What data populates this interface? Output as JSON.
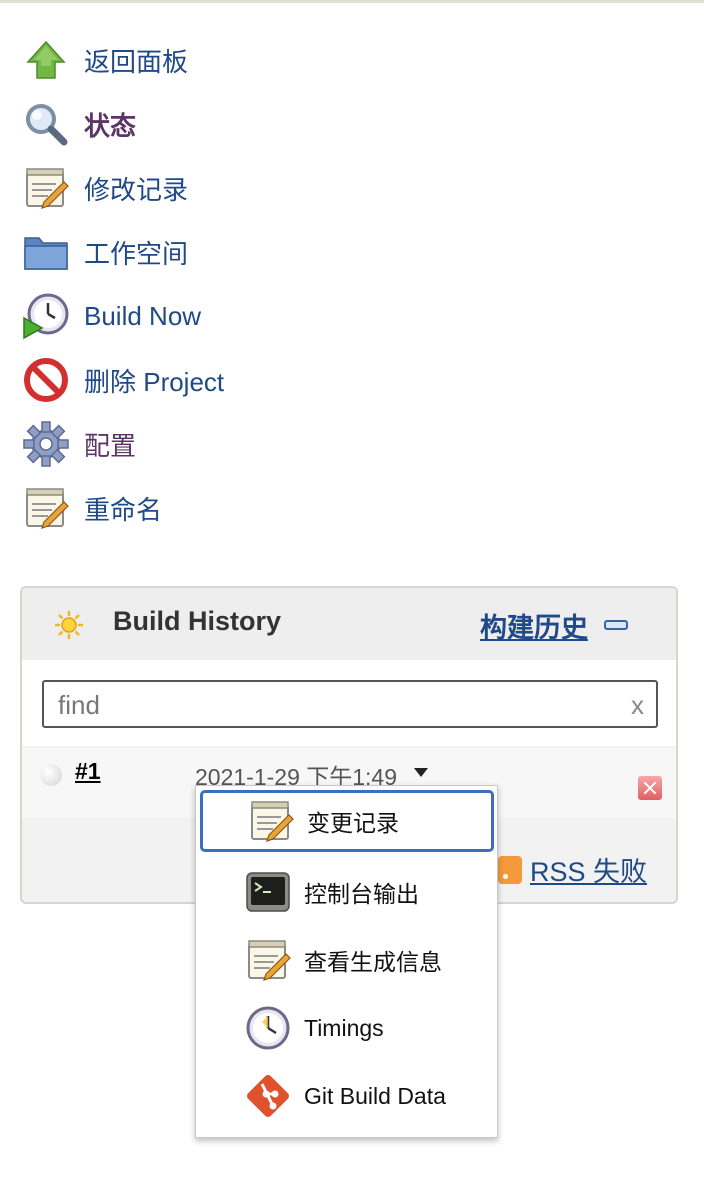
{
  "sidebar": {
    "items": [
      {
        "label": "返回面板",
        "icon": "up-arrow-icon"
      },
      {
        "label": "状态",
        "icon": "search-icon"
      },
      {
        "label": "修改记录",
        "icon": "notepad-icon"
      },
      {
        "label": "工作空间",
        "icon": "folder-icon"
      },
      {
        "label": "Build Now",
        "icon": "clock-play-icon"
      },
      {
        "label": "删除 Project",
        "icon": "no-entry-icon"
      },
      {
        "label": "配置",
        "icon": "gear-icon"
      },
      {
        "label": "重命名",
        "icon": "notepad-icon"
      }
    ]
  },
  "build_history": {
    "title": "Build History",
    "trend_link": "构建历史",
    "search": {
      "placeholder": "find",
      "value": "",
      "clear": "x"
    },
    "builds": [
      {
        "number": "#1",
        "date": "2021-1-29 下午1:49"
      }
    ],
    "rss_failed": "RSS 失败"
  },
  "dropdown": {
    "items": [
      {
        "label": "变更记录",
        "icon": "notepad-icon"
      },
      {
        "label": "控制台输出",
        "icon": "terminal-icon"
      },
      {
        "label": "查看生成信息",
        "icon": "notepad-icon"
      },
      {
        "label": "Timings",
        "icon": "clock-icon"
      },
      {
        "label": "Git Build Data",
        "icon": "git-icon"
      }
    ]
  },
  "colors": {
    "link": "#204a87",
    "visited": "#5c3566",
    "focus_ring": "#3a6fbf"
  }
}
